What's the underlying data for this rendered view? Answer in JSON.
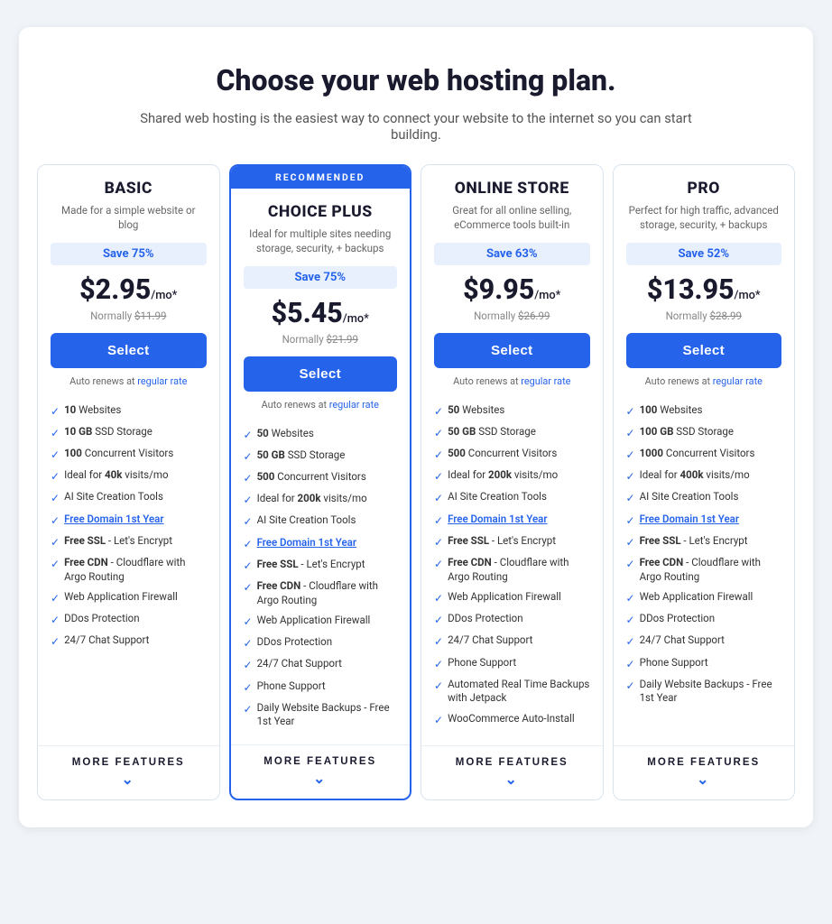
{
  "header": {
    "title": "Choose your web hosting plan.",
    "subtitle": "Shared web hosting is the easiest way to connect your website to the internet so you can start building."
  },
  "plans": [
    {
      "id": "basic",
      "recommended": false,
      "name": "BASIC",
      "desc": "Made for a simple website or blog",
      "save": "Save 75%",
      "price": "$2.95",
      "period": "/mo*",
      "normal": "$11.99",
      "select_label": "Select",
      "auto_renews": "Auto renews at",
      "regular_rate": "regular rate",
      "features": [
        {
          "bold": "10",
          "text": " Websites"
        },
        {
          "bold": "10 GB",
          "text": " SSD Storage"
        },
        {
          "bold": "100",
          "text": " Concurrent Visitors"
        },
        {
          "text": "Ideal for ",
          "bold": "40k",
          "text2": " visits/mo"
        },
        {
          "text": "AI Site Creation Tools"
        },
        {
          "link": "Free Domain 1st Year"
        },
        {
          "text": "Free SSL",
          "text2": " - Let's Encrypt"
        },
        {
          "text": "Free CDN",
          "text2": " - Cloudflare with Argo Routing"
        },
        {
          "text": "Web Application Firewall"
        },
        {
          "text": "DDos Protection"
        },
        {
          "text": "24/7 Chat Support"
        }
      ],
      "more_features": "MORE FEATURES"
    },
    {
      "id": "choice-plus",
      "recommended": true,
      "recommended_label": "RECOMMENDED",
      "name": "CHOICE PLUS",
      "desc": "Ideal for multiple sites needing storage, security, + backups",
      "save": "Save 75%",
      "price": "$5.45",
      "period": "/mo*",
      "normal": "$21.99",
      "select_label": "Select",
      "auto_renews": "Auto renews at",
      "regular_rate": "regular rate",
      "features": [
        {
          "bold": "50",
          "text": " Websites"
        },
        {
          "bold": "50 GB",
          "text": " SSD Storage"
        },
        {
          "bold": "500",
          "text": " Concurrent Visitors"
        },
        {
          "text": "Ideal for ",
          "bold": "200k",
          "text2": " visits/mo"
        },
        {
          "text": "AI Site Creation Tools"
        },
        {
          "link": "Free Domain 1st Year"
        },
        {
          "text": "Free SSL",
          "text2": " - Let's Encrypt"
        },
        {
          "text": "Free CDN",
          "text2": " - Cloudflare with Argo Routing"
        },
        {
          "text": "Web Application Firewall"
        },
        {
          "text": "DDos Protection"
        },
        {
          "text": "24/7 Chat Support"
        },
        {
          "text": "Phone Support"
        },
        {
          "text": "Daily Website Backups - Free 1st Year"
        }
      ],
      "more_features": "MORE FEATURES"
    },
    {
      "id": "online-store",
      "recommended": false,
      "name": "ONLINE STORE",
      "desc": "Great for all online selling, eCommerce tools built-in",
      "save": "Save 63%",
      "price": "$9.95",
      "period": "/mo*",
      "normal": "$26.99",
      "select_label": "Select",
      "auto_renews": "Auto renews at",
      "regular_rate": "regular rate",
      "features": [
        {
          "bold": "50",
          "text": " Websites"
        },
        {
          "bold": "50 GB",
          "text": " SSD Storage"
        },
        {
          "bold": "500",
          "text": " Concurrent Visitors"
        },
        {
          "text": "Ideal for ",
          "bold": "200k",
          "text2": " visits/mo"
        },
        {
          "text": "AI Site Creation Tools"
        },
        {
          "link": "Free Domain 1st Year"
        },
        {
          "text": "Free SSL",
          "text2": " - Let's Encrypt"
        },
        {
          "text": "Free CDN",
          "text2": " - Cloudflare with Argo Routing"
        },
        {
          "text": "Web Application Firewall"
        },
        {
          "text": "DDos Protection"
        },
        {
          "text": "24/7 Chat Support"
        },
        {
          "text": "Phone Support"
        },
        {
          "text": "Automated Real Time Backups with Jetpack"
        },
        {
          "text": "WooCommerce Auto-Install"
        }
      ],
      "more_features": "MORE FEATURES"
    },
    {
      "id": "pro",
      "recommended": false,
      "name": "PRO",
      "desc": "Perfect for high traffic, advanced storage, security, + backups",
      "save": "Save 52%",
      "price": "$13.95",
      "period": "/mo*",
      "normal": "$28.99",
      "select_label": "Select",
      "auto_renews": "Auto renews at",
      "regular_rate": "regular rate",
      "features": [
        {
          "bold": "100",
          "text": " Websites"
        },
        {
          "bold": "100 GB",
          "text": " SSD Storage"
        },
        {
          "bold": "1000",
          "text": " Concurrent Visitors"
        },
        {
          "text": "Ideal for ",
          "bold": "400k",
          "text2": " visits/mo"
        },
        {
          "text": "AI Site Creation Tools"
        },
        {
          "link": "Free Domain 1st Year"
        },
        {
          "text": "Free SSL",
          "text2": " - Let's Encrypt"
        },
        {
          "text": "Free CDN",
          "text2": " - Cloudflare with Argo Routing"
        },
        {
          "text": "Web Application Firewall"
        },
        {
          "text": "DDos Protection"
        },
        {
          "text": "24/7 Chat Support"
        },
        {
          "text": "Phone Support"
        },
        {
          "text": "Daily Website Backups - Free 1st Year"
        }
      ],
      "more_features": "MORE FEATURES"
    }
  ]
}
